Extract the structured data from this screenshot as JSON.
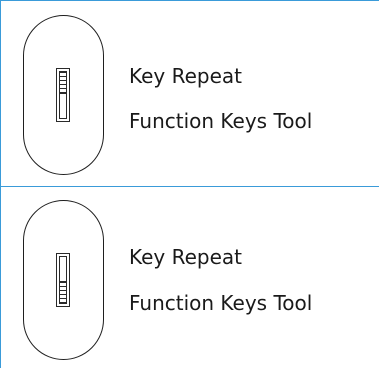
{
  "items": [
    {
      "title": "Key Repeat",
      "subtitle": "Function Keys Tool",
      "switch_position": "up",
      "switch_icon": "toggle-switch-icon"
    },
    {
      "title": "Key Repeat",
      "subtitle": "Function Keys Tool",
      "switch_position": "down",
      "switch_icon": "toggle-switch-icon"
    }
  ],
  "colors": {
    "divider": "#3a9bd9",
    "outline": "#1f1f1f",
    "text": "#1a1a1a"
  }
}
